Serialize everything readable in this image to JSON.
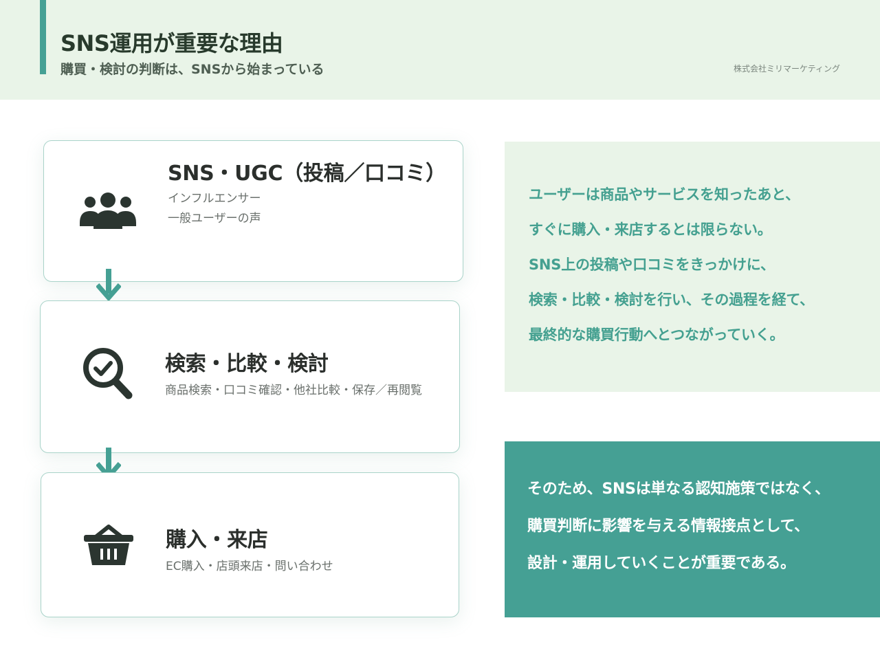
{
  "header": {
    "title": "SNS運用が重要な理由",
    "subtitle": "購買・検討の判断は、SNSから始まっている",
    "company": "株式会社ミリマーケティング"
  },
  "steps": [
    {
      "icon": "users-group-icon",
      "title": "SNS・UGC（投稿／口コミ）",
      "sub_lines": [
        "インフルエンサー",
        "一般ユーザーの声"
      ]
    },
    {
      "icon": "search-check-icon",
      "title": "検索・比較・検討",
      "sub_lines": [
        "商品検索・口コミ確認・他社比較・保存／再閲覧"
      ]
    },
    {
      "icon": "shopping-basket-icon",
      "title": "購入・来店",
      "sub_lines": [
        "EC購入・店頭来店・問い合わせ"
      ]
    }
  ],
  "explanation": {
    "lines": [
      "ユーザーは商品やサービスを知ったあと、",
      "すぐに購入・来店するとは限らない。",
      "SNS上の投稿や口コミをきっかけに、",
      "検索・比較・検討を行い、その過程を経て、",
      "最終的な購買行動へとつながっていく。"
    ]
  },
  "conclusion": {
    "lines": [
      "そのため、SNSは単なる認知施策ではなく、",
      "購買判断に影響を与える情報接点として、",
      "設計・運用していくことが重要である。"
    ]
  },
  "colors": {
    "accent": "#45a094",
    "header_bg": "#e9f4e8",
    "icon": "#2b3530"
  }
}
